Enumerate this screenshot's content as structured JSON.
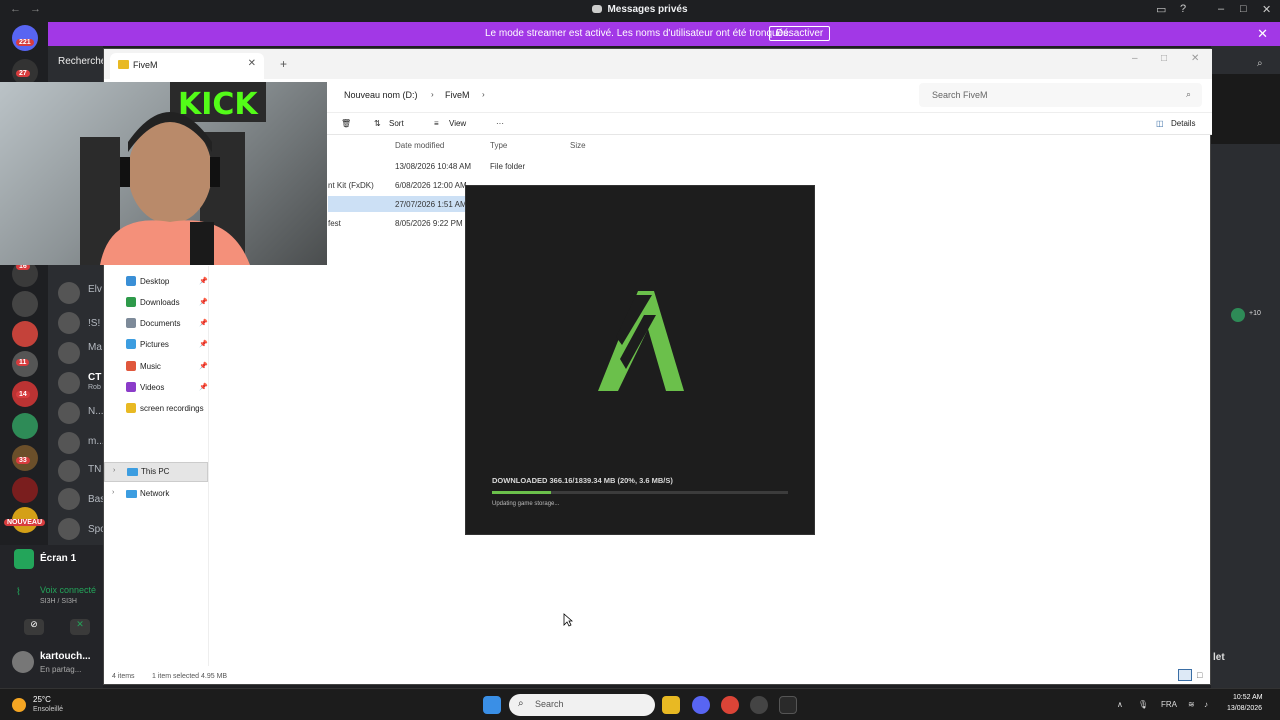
{
  "discord": {
    "window_title": "Messages privés",
    "streamer_banner": {
      "message": "Le mode streamer est activé. Les noms d'utilisateur ont été tronqués.",
      "button": "Désactiver"
    },
    "search_label": "Recherche",
    "server_badges": [
      "221",
      "27",
      "16",
      "14",
      "11",
      "14",
      "33"
    ],
    "new_badge": "NOUVEAU",
    "dm_fragments": [
      "Elv",
      "!S!",
      "Ma",
      "CT",
      "N...",
      "m...",
      "TN",
      "Bas",
      "Spo"
    ],
    "dm_subtitle": "Rob",
    "screen_share": "Écran 1",
    "voice_status": "Voix connecté",
    "voice_channel": "SI3H / SI3H",
    "user_name": "kartouch...",
    "user_status": "En partag...",
    "right_strip_badge": "+10",
    "right_strip_fragment": "let"
  },
  "explorer": {
    "tab_title": "FiveM",
    "breadcrumb": [
      "Nouveau nom (D:)",
      "FiveM"
    ],
    "search_placeholder": "Search FiveM",
    "toolbar": {
      "sort": "Sort",
      "view": "View",
      "details": "Details"
    },
    "columns": [
      "Date modified",
      "Type",
      "Size"
    ],
    "rows": [
      {
        "name": "",
        "date": "13/08/2026 10:48 AM",
        "type": "File folder",
        "size": ""
      },
      {
        "name": "nt Kit (FxDK)",
        "date": "6/08/2026 12:00 AM",
        "type": "",
        "size": ""
      },
      {
        "name": "",
        "date": "27/07/2026 1:51 AM",
        "type": "",
        "size": ""
      },
      {
        "name": "fest",
        "date": "8/05/2026 9:22 PM",
        "type": "",
        "size": ""
      }
    ],
    "nav_items": [
      {
        "label": "Desktop",
        "color": "#3a8fd6",
        "pinned": true
      },
      {
        "label": "Downloads",
        "color": "#2e9a4a",
        "pinned": true
      },
      {
        "label": "Documents",
        "color": "#7d8a99",
        "pinned": true
      },
      {
        "label": "Pictures",
        "color": "#3c9de0",
        "pinned": true
      },
      {
        "label": "Music",
        "color": "#e0573c",
        "pinned": true
      },
      {
        "label": "Videos",
        "color": "#8b3cc9",
        "pinned": true
      },
      {
        "label": "screen recordings",
        "color": "#e8b923",
        "pinned": false
      }
    ],
    "this_pc": "This PC",
    "network": "Network",
    "status_items": "4 items",
    "status_selected": "1 item selected  4.95 MB"
  },
  "fivem": {
    "status": "DOWNLOADED 366.16/1839.34 MB (20%, 3.6 MB/S)",
    "progress": 0.2,
    "substatus": "Updating game storage...",
    "accent": "#6bc04b"
  },
  "webcam": {
    "sign_text": "KICK"
  },
  "taskbar": {
    "weather_temp": "25°C",
    "weather_desc": "Ensoleillé",
    "search_placeholder": "Search",
    "lang": "FRA",
    "time": "10:52 AM",
    "date": "13/08/2026"
  }
}
